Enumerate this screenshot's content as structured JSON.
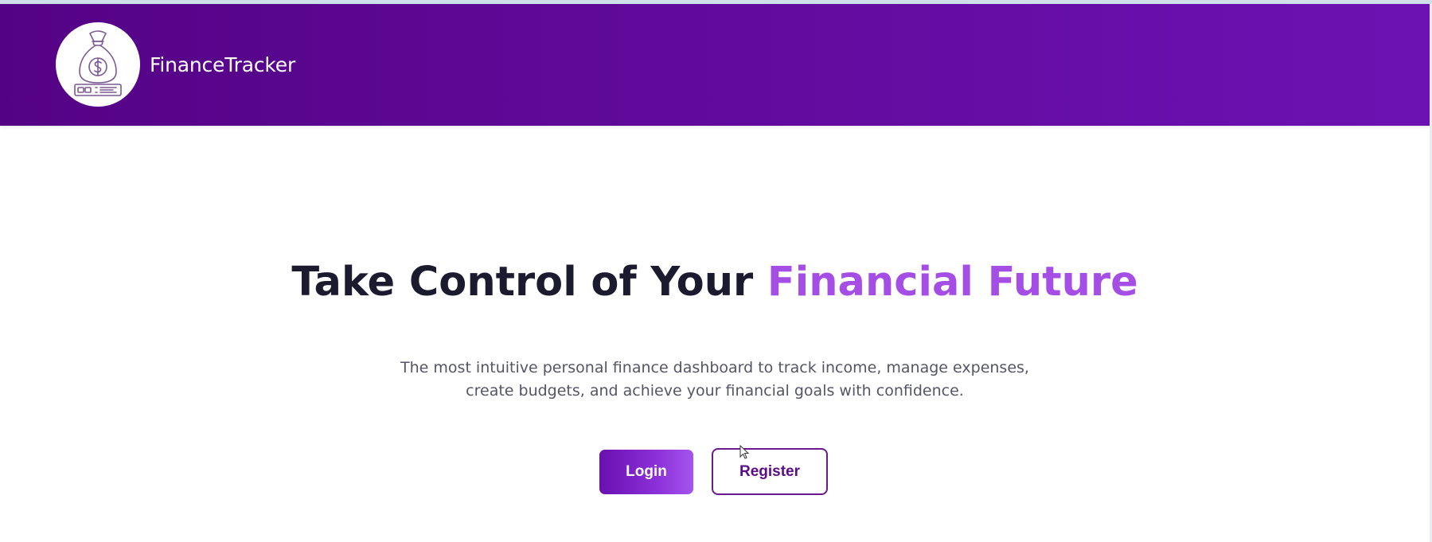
{
  "header": {
    "brand": "FinanceTracker",
    "logo_icon": "money-bag-icon"
  },
  "hero": {
    "title_main": "Take Control of Your ",
    "title_accent": "Financial Future",
    "subtitle_line1": "The most intuitive personal finance dashboard to track income, manage expenses,",
    "subtitle_line2": "create budgets, and achieve your financial goals with confidence."
  },
  "actions": {
    "login_label": "Login",
    "register_label": "Register"
  },
  "colors": {
    "header_gradient_start": "#540285",
    "header_gradient_end": "#6c12b3",
    "accent": "#a54ee6",
    "title": "#1c1a2e",
    "register_border": "#6a1a8e"
  }
}
